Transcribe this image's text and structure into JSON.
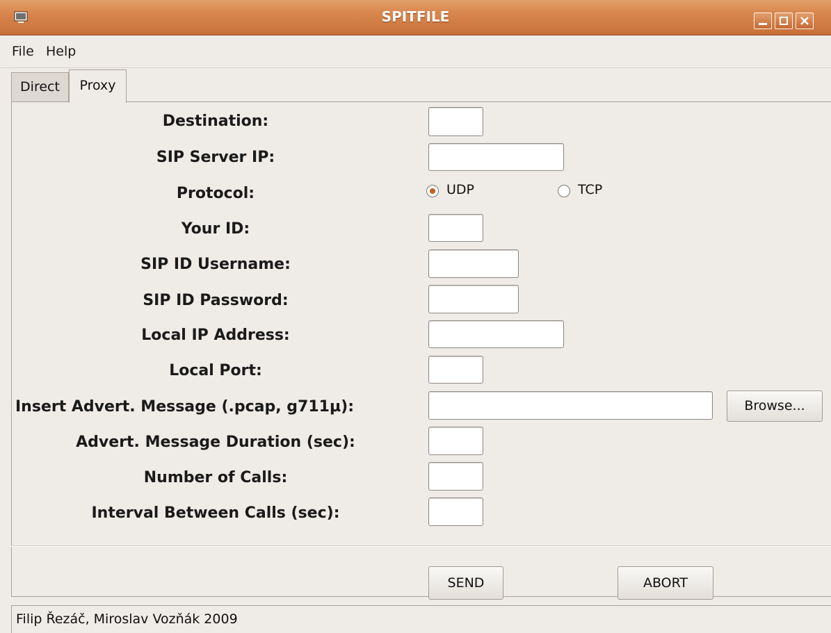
{
  "window": {
    "title": "SPITFILE"
  },
  "menu": {
    "file": "File",
    "help": "Help"
  },
  "tabs": {
    "direct": "Direct",
    "proxy": "Proxy",
    "active": "Proxy"
  },
  "form": {
    "destination_label": "Destination:",
    "sip_server_ip_label": "SIP Server IP:",
    "protocol_label": "Protocol:",
    "protocol_options": [
      "UDP",
      "TCP"
    ],
    "protocol_selected": "UDP",
    "your_id_label": "Your ID:",
    "sip_id_username_label": "SIP ID Username:",
    "sip_id_password_label": "SIP ID Password:",
    "local_ip_label": "Local IP Address:",
    "local_port_label": "Local Port:",
    "advert_message_label": "Insert Advert. Message (.pcap, g711µ):",
    "browse_label": "Browse...",
    "advert_duration_label": "Advert. Message Duration (sec):",
    "number_of_calls_label": "Number of Calls:",
    "interval_label": "Interval Between Calls (sec):",
    "values": {
      "destination": "",
      "sip_server_ip": "",
      "your_id": "",
      "sip_id_username": "",
      "sip_id_password": "",
      "local_ip": "",
      "local_port": "",
      "advert_message": "",
      "advert_duration": "",
      "number_of_calls": "",
      "interval": ""
    }
  },
  "actions": {
    "send": "SEND",
    "abort": "ABORT"
  },
  "status": {
    "text": "Filip Řezáč, Miroslav Vozňák 2009"
  },
  "colors": {
    "titlebar": "#d9884f",
    "radio_selected": "#c55f21",
    "background": "#efebe7"
  }
}
